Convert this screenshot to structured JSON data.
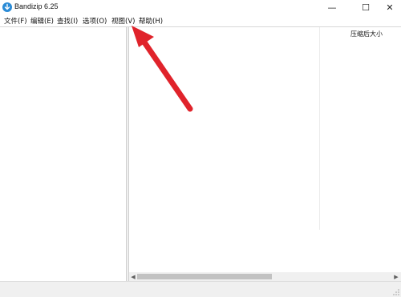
{
  "window": {
    "title": "Bandizip 6.25",
    "controls": {
      "minimize": "—",
      "maximize": "☐",
      "close": "✕"
    }
  },
  "menu": {
    "items": [
      {
        "label": "文件(F)"
      },
      {
        "label": "编辑(E)"
      },
      {
        "label": "查找(I)"
      },
      {
        "label": "选项(O)"
      },
      {
        "label": "视图(V)"
      },
      {
        "label": "帮助(H)"
      }
    ]
  },
  "file_list": {
    "columns": [
      "压缩后大小"
    ]
  },
  "colors": {
    "app_icon": "#2a8bd6",
    "annotation_arrow": "#e0232b"
  },
  "icons": {
    "app": "bandizip-icon",
    "annotation": "red-arrow-icon"
  }
}
